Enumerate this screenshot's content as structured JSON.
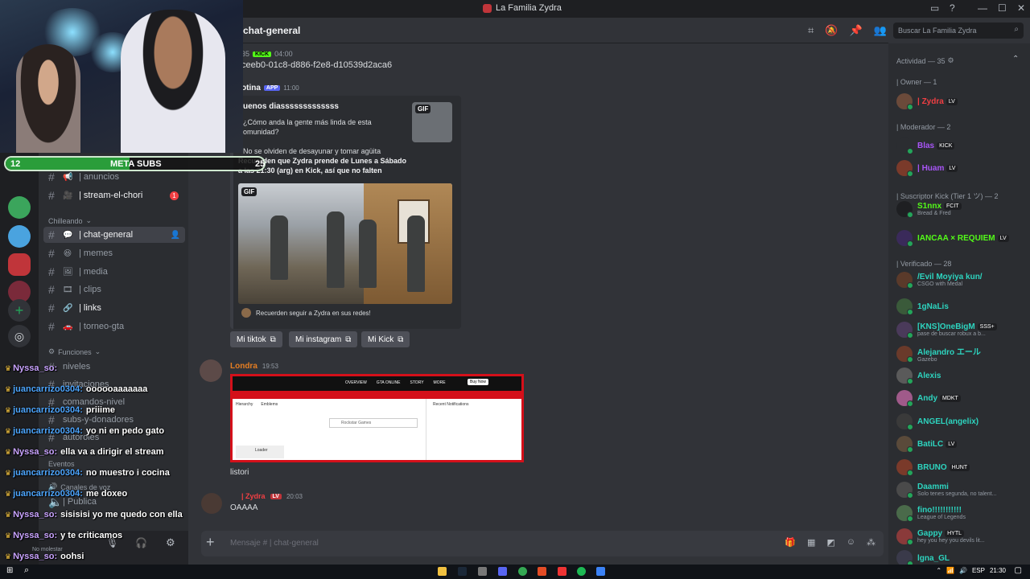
{
  "window": {
    "title": "La Familia Zydra",
    "controls": {
      "minimize": "—",
      "maximize": "☐",
      "close": "✕"
    }
  },
  "channel_sidebar": {
    "channels_top": [
      {
        "label": "| anuncios"
      },
      {
        "label": "| stream-el-chori",
        "badge": "1"
      }
    ],
    "category_chilleando": "Chilleando",
    "channels": [
      {
        "label": "| chat-general"
      },
      {
        "label": "| memes"
      },
      {
        "label": "| media"
      },
      {
        "label": "| clips"
      },
      {
        "label": "| links"
      },
      {
        "label": "| torneo-gta"
      }
    ],
    "category_funciones": "Funciones",
    "funciones": [
      {
        "label": "niveles"
      },
      {
        "label": "invitaciones"
      },
      {
        "label": "comandos-nivel"
      },
      {
        "label": "subs-y-donadores"
      },
      {
        "label": "autoroles"
      }
    ],
    "category_eventos": "Eventos",
    "category_voz": "Canales de voz",
    "voice_public": "| Publica",
    "user_status": "No molestar"
  },
  "header": {
    "channel_name": "chat-general",
    "search_placeholder": "Buscar La Familia Zydra"
  },
  "messages": {
    "m1": {
      "time": "04:00",
      "kick_tag": "KICK",
      "text": "ceeb0-01c8-d886-f2e8-d10539d2aca6",
      "num": "35"
    },
    "m2": {
      "author": "otina",
      "app_tag": "APP",
      "time": "11:00",
      "embed_title": "uenos diasssssssssssss",
      "embed_line1": "¿Cómo anda la gente más linda de esta",
      "embed_line2": "omunidad?",
      "embed_line3": "No se olviden de desayunar y tomar agüita",
      "embed_line4": "Recuerden que Zydra prende de Lunes a Sábado",
      "embed_line5": "a las 21:30 (arg) en Kick, así que no falten",
      "gif_label": "GIF",
      "footer": "Recuerden seguir a Zydra en sus redes!"
    },
    "buttons": [
      "Mi tiktok",
      "Mi instagram",
      "Mi Kick"
    ],
    "m3": {
      "author": "Londra",
      "time": "19:53",
      "text": "listori",
      "shot_nav": [
        "OVERVIEW",
        "GTA ONLINE",
        "STORY",
        "MORE"
      ],
      "shot_buy": "Buy Now",
      "shot_tabs": [
        "Hierarchy",
        "Emblems"
      ],
      "shot_search": "Rockstar Games",
      "shot_panel": "Recent Notifications",
      "shot_loader": "Loader"
    },
    "m4": {
      "author": "| Zydra",
      "lv": "LV",
      "time": "20:03",
      "text": "OAAAA"
    }
  },
  "composer": {
    "placeholder": "Mensaje #  | chat-general"
  },
  "members": {
    "actividad": "Actividad — 35",
    "owner_cat": "| Owner — 1",
    "moderador_cat": "| Moderador — 2",
    "suscriptor_cat": "| Suscriptor Kick (Tier 1 ツ) — 2",
    "verificado_cat": "| Verificado — 28",
    "list": [
      {
        "name": "| Zydra",
        "tag": "LV",
        "color": "#f23f43",
        "sub": ""
      },
      {
        "name": "Blas",
        "tag": "KICK",
        "color": "#a855f7",
        "sub": ""
      },
      {
        "name": "| Huam",
        "tag": "LV",
        "color": "#a855f7",
        "sub": ""
      },
      {
        "name": "S1nnx",
        "tag": "FCIT",
        "color": "#53fc18",
        "sub": "Bread & Fred"
      },
      {
        "name": "IANCAA × REQUIEM",
        "tag": "LV",
        "color": "#53fc18",
        "sub": ""
      },
      {
        "name": "/Evil Moyiya kun/",
        "tag": "",
        "color": "#2dd4bf",
        "sub": "CSGO with Medal"
      },
      {
        "name": "1gNaLis",
        "tag": "",
        "color": "#2dd4bf",
        "sub": ""
      },
      {
        "name": "[KNS]OneBigM",
        "tag": "SSS+",
        "color": "#2dd4bf",
        "sub": "pase de buscar robux a b..."
      },
      {
        "name": "Alejandro エール",
        "tag": "",
        "color": "#2dd4bf",
        "sub": "Gazebo"
      },
      {
        "name": "Alexis",
        "tag": "",
        "color": "#2dd4bf",
        "sub": ""
      },
      {
        "name": "Andy",
        "tag": "MDKT",
        "color": "#2dd4bf",
        "sub": ""
      },
      {
        "name": "ANGEL(angelix)",
        "tag": "",
        "color": "#2dd4bf",
        "sub": ""
      },
      {
        "name": "BatiLC",
        "tag": "LV",
        "color": "#2dd4bf",
        "sub": ""
      },
      {
        "name": "BRUNO",
        "tag": "HUNT",
        "color": "#2dd4bf",
        "sub": ""
      },
      {
        "name": "Daammi",
        "tag": "",
        "color": "#2dd4bf",
        "sub": "Solo tenes segunda, no talent..."
      },
      {
        "name": "fino!!!!!!!!!!!",
        "tag": "",
        "color": "#2dd4bf",
        "sub": "League of Legends"
      },
      {
        "name": "Gappy",
        "tag": "HYTL",
        "color": "#2dd4bf",
        "sub": "hey you hey you devils lit..."
      },
      {
        "name": "lgna_GL",
        "tag": "",
        "color": "#2dd4bf",
        "sub": ""
      }
    ]
  },
  "overlay": {
    "meta_left": "12",
    "meta_center": "META SUBS",
    "meta_right": "25",
    "meta_progress": 0.48,
    "chat": [
      {
        "user": "Nyssa_so:",
        "text": "",
        "cls": "u1"
      },
      {
        "user": "juancarrizo0304:",
        "text": "oooooaaaaaaa",
        "cls": "u2"
      },
      {
        "user": "juancarrizo0304:",
        "text": "priiime",
        "cls": "u2"
      },
      {
        "user": "juancarrizo0304:",
        "text": "yo ni en pedo gato",
        "cls": "u2"
      },
      {
        "user": "Nyssa_so:",
        "text": "ella va a dirigir el stream",
        "cls": "u1"
      },
      {
        "user": "juancarrizo0304:",
        "text": "no muestro i cocina",
        "cls": "u2"
      },
      {
        "user": "juancarrizo0304:",
        "text": "me doxeo",
        "cls": "u2"
      },
      {
        "user": "Nyssa_so:",
        "text": "sisisisi yo me quedo con ella",
        "cls": "u1"
      },
      {
        "user": "Nyssa_so:",
        "text": "y te criticamos",
        "cls": "u1"
      },
      {
        "user": "Nyssa_so:",
        "text": "oohsi",
        "cls": "u1"
      }
    ]
  },
  "taskbar": {
    "lang": "ESP",
    "time": "21:30"
  }
}
